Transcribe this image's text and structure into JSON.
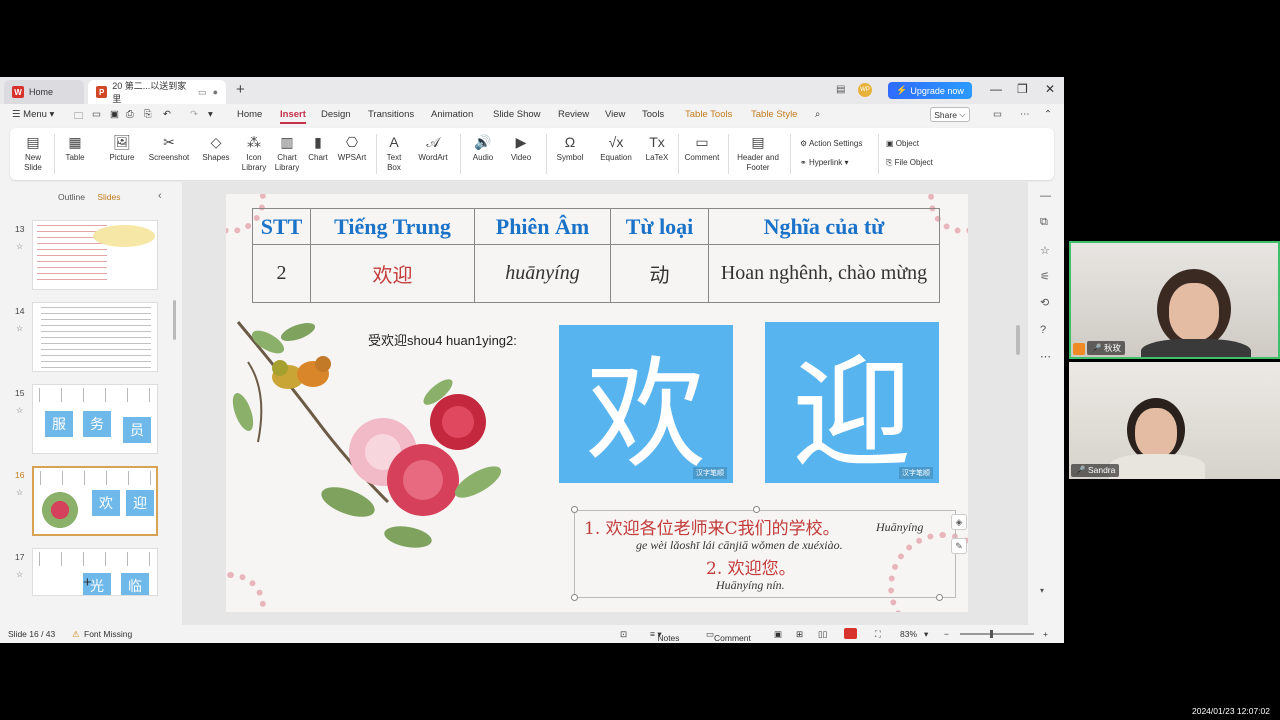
{
  "titlebar": {
    "home_tab": "Home",
    "doc_tab": "20 第二...以送到家里",
    "upgrade": "Upgrade now",
    "avatar": "WP"
  },
  "menu": {
    "menu_label": "Menu",
    "items": [
      "Home",
      "Insert",
      "Design",
      "Transitions",
      "Animation",
      "Slide Show",
      "Review",
      "View",
      "Tools",
      "Table Tools",
      "Table Style"
    ],
    "active": "Insert",
    "share": "Share"
  },
  "ribbon": {
    "new_slide": "New Slide",
    "table": "Table",
    "picture": "Picture",
    "screenshot": "Screenshot",
    "shapes": "Shapes",
    "icon_library": "Icon Library",
    "chart_library": "Chart Library",
    "chart": "Chart",
    "wpsart": "WPSArt",
    "text_box": "Text Box",
    "wordart": "WordArt",
    "audio": "Audio",
    "video": "Video",
    "symbol": "Symbol",
    "equation": "Equation",
    "latex": "LaTeX",
    "comment": "Comment",
    "header_footer": "Header and Footer",
    "action_settings": "Action Settings",
    "hyperlink": "Hyperlink",
    "object": "Object",
    "file_object": "File Object"
  },
  "panel": {
    "outline": "Outline",
    "slides": "Slides",
    "thumbs": [
      {
        "num": "13"
      },
      {
        "num": "14"
      },
      {
        "num": "15",
        "chars": [
          "服",
          "务",
          "员"
        ]
      },
      {
        "num": "16",
        "chars": [
          "欢",
          "迎"
        ]
      },
      {
        "num": "17",
        "chars": [
          "光",
          "临"
        ]
      }
    ]
  },
  "slide": {
    "headers": [
      "STT",
      "Tiếng Trung",
      "Phiên Âm",
      "Từ loại",
      "Nghĩa của từ"
    ],
    "row": [
      "2",
      "欢迎",
      "huānyíng",
      "动",
      "Hoan nghênh, chào mừng"
    ],
    "subtitle": "受欢迎shou4 huan1ying2:",
    "card1": "欢",
    "card2": "迎",
    "card_mark": "汉字笔顺",
    "ex1": "1. 欢迎各位老师来C我们的学校。",
    "ex1_py_a": "Huānyíng",
    "ex1_py_b": "ge wèi lǎoshī lái cānjiā wǒmen de xuéxiào.",
    "ex2": "2. 欢迎您。",
    "ex2_py": "Huānyíng nín."
  },
  "status": {
    "slide": "Slide 16 / 43",
    "font_missing": "Font Missing",
    "notes": "Notes",
    "comment": "Comment",
    "zoom": "83%"
  },
  "video": {
    "participant1": "秋玫",
    "participant2": "Sandra",
    "timestamp": "2024/01/23 12:07:02"
  }
}
